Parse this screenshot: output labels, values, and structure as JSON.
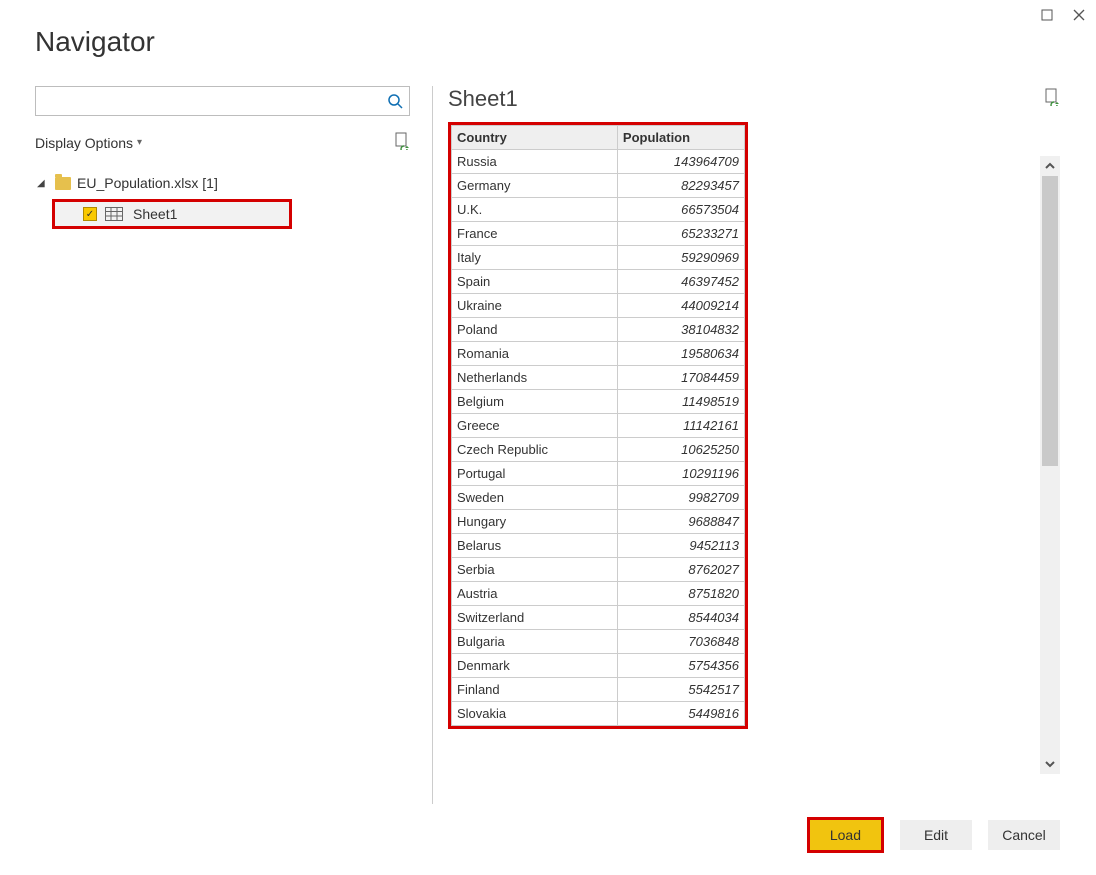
{
  "window": {
    "title": "Navigator"
  },
  "left": {
    "search_placeholder": "",
    "display_options": "Display Options",
    "file_label": "EU_Population.xlsx [1]",
    "sheet_label": "Sheet1"
  },
  "preview": {
    "title": "Sheet1",
    "columns": [
      "Country",
      "Population"
    ],
    "rows": [
      {
        "country": "Russia",
        "population": "143964709"
      },
      {
        "country": "Germany",
        "population": "82293457"
      },
      {
        "country": "U.K.",
        "population": "66573504"
      },
      {
        "country": "France",
        "population": "65233271"
      },
      {
        "country": "Italy",
        "population": "59290969"
      },
      {
        "country": "Spain",
        "population": "46397452"
      },
      {
        "country": "Ukraine",
        "population": "44009214"
      },
      {
        "country": "Poland",
        "population": "38104832"
      },
      {
        "country": "Romania",
        "population": "19580634"
      },
      {
        "country": "Netherlands",
        "population": "17084459"
      },
      {
        "country": "Belgium",
        "population": "11498519"
      },
      {
        "country": "Greece",
        "population": "11142161"
      },
      {
        "country": "Czech Republic",
        "population": "10625250"
      },
      {
        "country": "Portugal",
        "population": "10291196"
      },
      {
        "country": "Sweden",
        "population": "9982709"
      },
      {
        "country": "Hungary",
        "population": "9688847"
      },
      {
        "country": "Belarus",
        "population": "9452113"
      },
      {
        "country": "Serbia",
        "population": "8762027"
      },
      {
        "country": "Austria",
        "population": "8751820"
      },
      {
        "country": "Switzerland",
        "population": "8544034"
      },
      {
        "country": "Bulgaria",
        "population": "7036848"
      },
      {
        "country": "Denmark",
        "population": "5754356"
      },
      {
        "country": "Finland",
        "population": "5542517"
      },
      {
        "country": "Slovakia",
        "population": "5449816"
      }
    ]
  },
  "buttons": {
    "load": "Load",
    "edit": "Edit",
    "cancel": "Cancel"
  }
}
